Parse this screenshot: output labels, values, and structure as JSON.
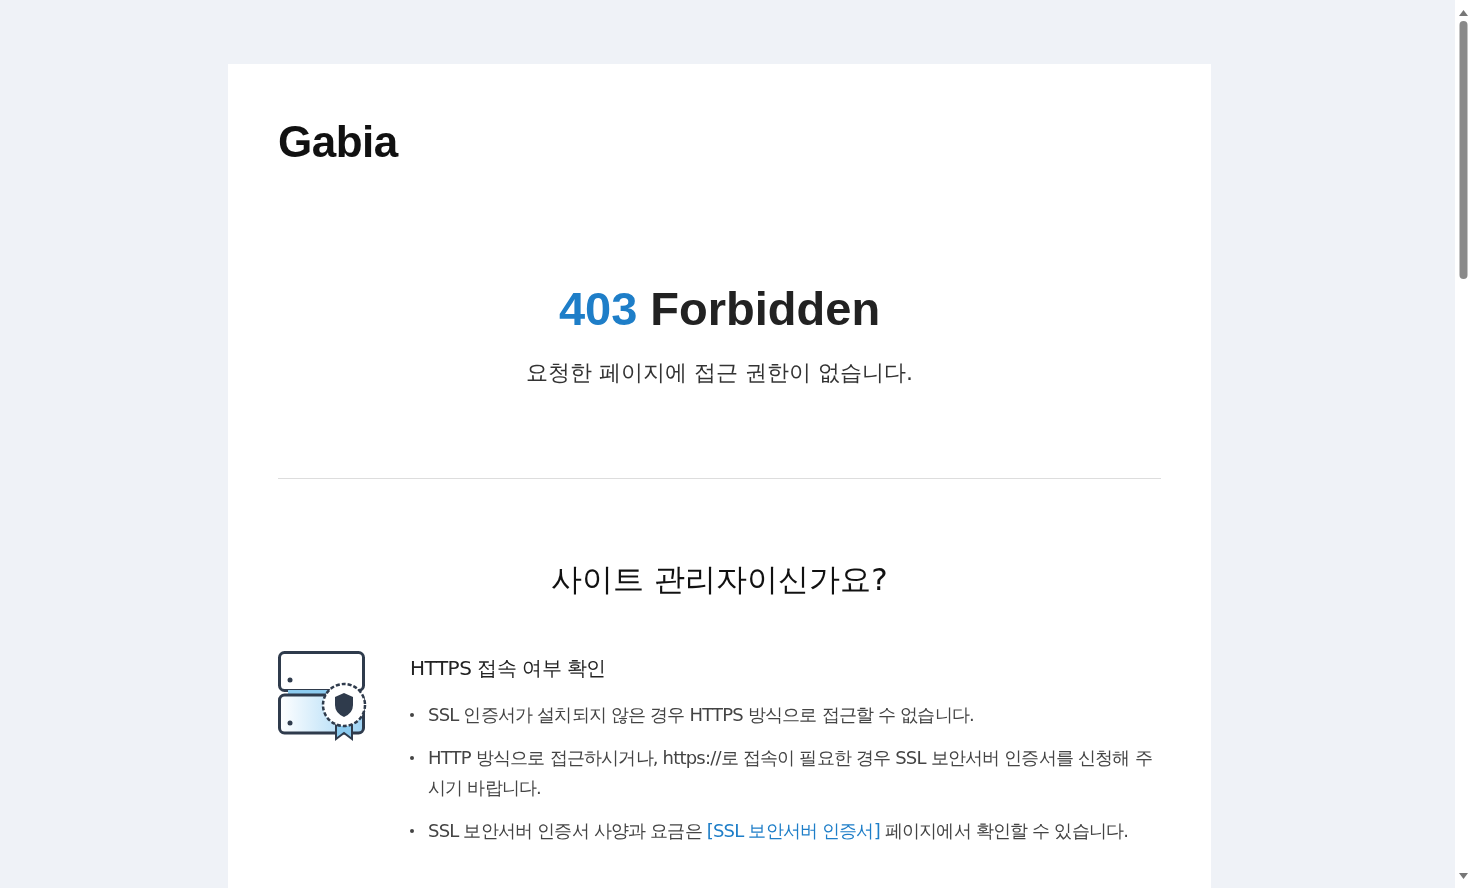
{
  "logo": "Gabia",
  "error": {
    "code": "403",
    "title": "Forbidden",
    "message": "요청한 페이지에 접근 권한이 없습니다."
  },
  "admin_heading": "사이트 관리자이신가요?",
  "sections": [
    {
      "title": "HTTPS 접속 여부 확인",
      "bullets": [
        [
          {
            "kind": "text",
            "text": "SSL 인증서가 설치되지 않은 경우 HTTPS 방식으로 접근할 수 없습니다."
          }
        ],
        [
          {
            "kind": "text",
            "text": "HTTP 방식으로 접근하시거나, https://로 접속이 필요한 경우 SSL 보안서버 인증서를 신청해 주시기 바랍니다."
          }
        ],
        [
          {
            "kind": "text",
            "text": "SSL 보안서버 인증서 사양과 요금은 "
          },
          {
            "kind": "link",
            "text": "[SSL 보안서버 인증서]"
          },
          {
            "kind": "text",
            "text": " 페이지에서 확인할 수 있습니다."
          }
        ]
      ]
    }
  ]
}
